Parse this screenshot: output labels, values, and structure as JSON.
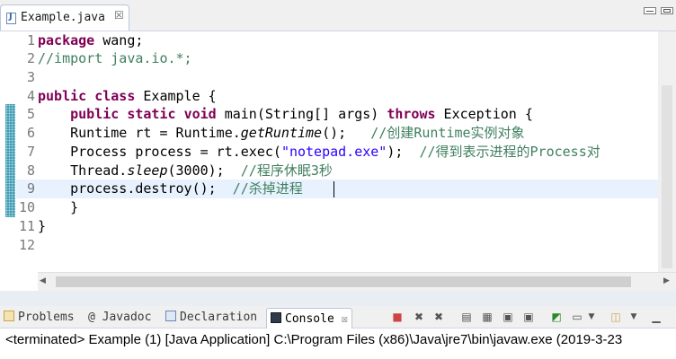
{
  "editor": {
    "tab_title": "Example.java",
    "tab_close_glyph": "☒",
    "line_numbers": [
      "1",
      "2",
      "3",
      "4",
      "5",
      "6",
      "7",
      "8",
      "9",
      "10",
      "11",
      "12"
    ],
    "lines": {
      "l1": {
        "kw": "package",
        "rest": " wang;"
      },
      "l2": {
        "comment": "//import java.io.*;"
      },
      "l4": {
        "kw1": "public",
        "kw2": "class",
        "rest": " Example {"
      },
      "l5": {
        "indent": "    ",
        "kw1": "public",
        "kw2": "static",
        "kw3": "void",
        "mid": " main(String[] args) ",
        "kw4": "throws",
        "rest": " Exception {"
      },
      "l6": {
        "pre": "    Runtime rt = Runtime.",
        "italic": "getRuntime",
        "post": "();   ",
        "comment": "//创建Runtime实例对象"
      },
      "l7": {
        "pre": "    Process process = rt.exec(",
        "str": "\"notepad.exe\"",
        "post": ");  ",
        "comment": "//得到表示进程的Process对"
      },
      "l8": {
        "pre": "    Thread.",
        "italic": "sleep",
        "post": "(3000);  ",
        "comment": "//程序休眠3秒"
      },
      "l9": {
        "pre": "    process.destroy();  ",
        "comment": "//杀掉进程"
      },
      "l10": {
        "text": "    }"
      },
      "l11": {
        "text": "}"
      }
    }
  },
  "panel": {
    "tabs": {
      "problems": "Problems",
      "javadoc_at": "@",
      "javadoc": "Javadoc",
      "declaration": "Declaration",
      "console": "Console"
    },
    "tools": [
      "stop-icon",
      "remove-launch-icon",
      "remove-all-icon",
      "clear-console-icon",
      "scroll-lock-icon",
      "word-wrap-icon",
      "show-on-output-icon",
      "pin-console-icon",
      "display-console-icon",
      "open-console-icon",
      "minimize-icon"
    ],
    "console_text": "<terminated> Example (1) [Java Application] C:\\Program Files (x86)\\Java\\jre7\\bin\\javaw.exe (2019-3-23"
  },
  "colors": {
    "keyword": "#7f0055",
    "comment": "#3f7f5f",
    "string": "#2a00ff",
    "current_line": "#e8f2fe",
    "annotation": "#3e9cb3"
  }
}
